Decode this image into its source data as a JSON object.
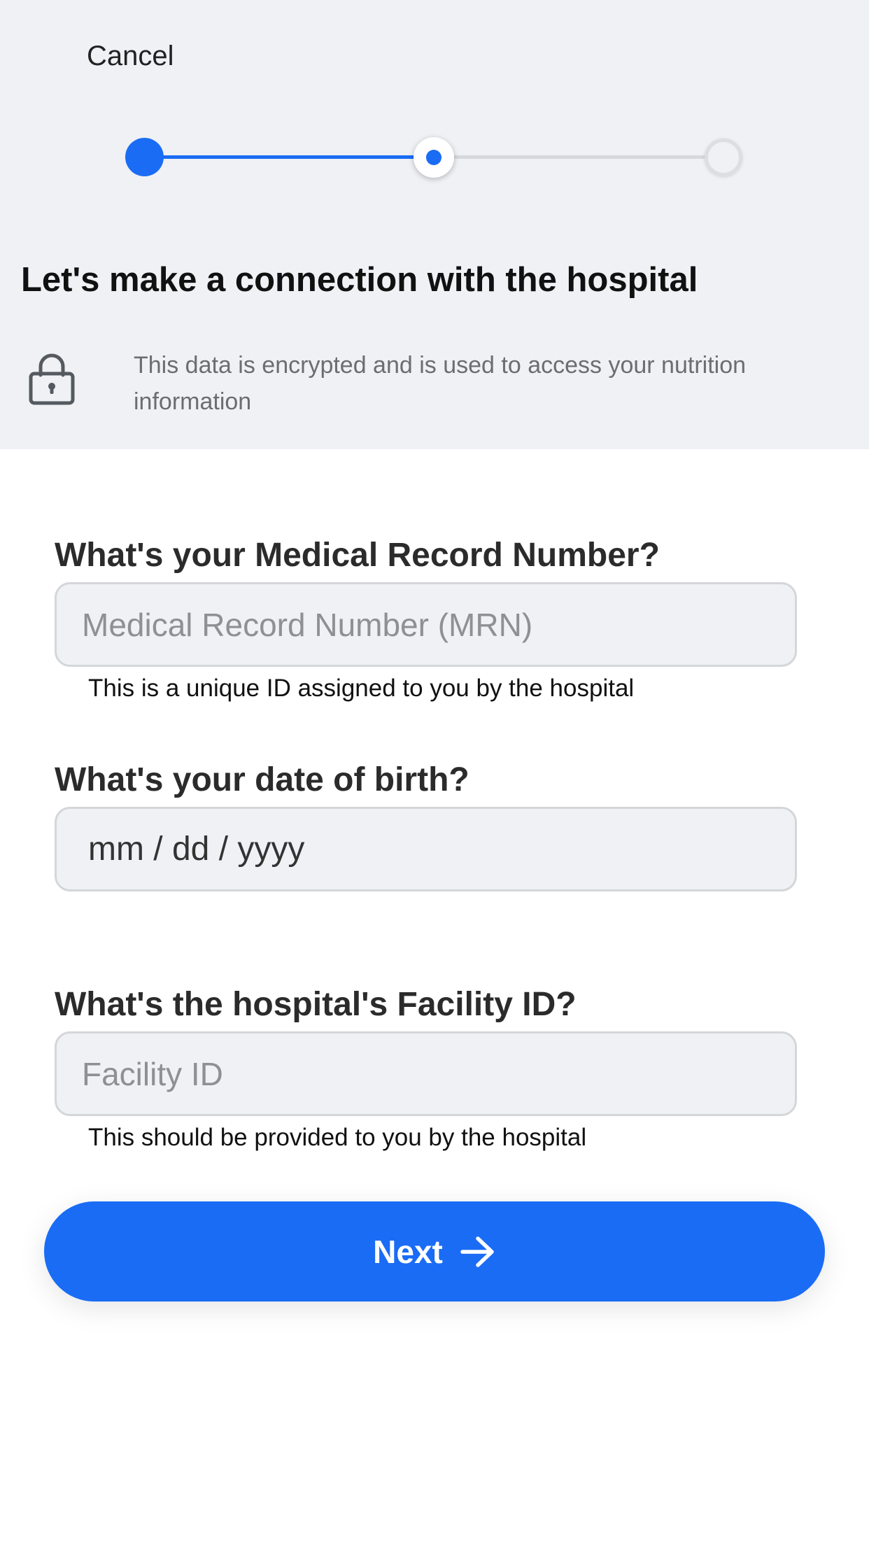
{
  "header": {
    "cancel_label": "Cancel",
    "title": "Let's make a connection with the hospital",
    "notice_text": "This data is encrypted and is used to access your nutrition information",
    "lock_icon": "lock-icon"
  },
  "stepper": {
    "total_steps": 3,
    "current_step": 2,
    "steps": [
      "complete",
      "current",
      "pending"
    ],
    "accent_color": "#1a6cf5",
    "inactive_color": "#d6d8dc"
  },
  "form": {
    "mrn": {
      "label": "What's your Medical Record Number?",
      "placeholder": "Medical Record Number (MRN)",
      "value": "",
      "hint": "This is a unique ID assigned to you by the hospital"
    },
    "dob": {
      "label": "What's your date of birth?",
      "value": "mm / dd / yyyy"
    },
    "facility": {
      "label": "What's the hospital's Facility ID?",
      "placeholder": "Facility ID",
      "value": "",
      "hint": "This should be provided to you by the hospital"
    }
  },
  "next_button": {
    "label": "Next",
    "icon": "arrow-right-icon",
    "color": "#1a6cf5"
  }
}
